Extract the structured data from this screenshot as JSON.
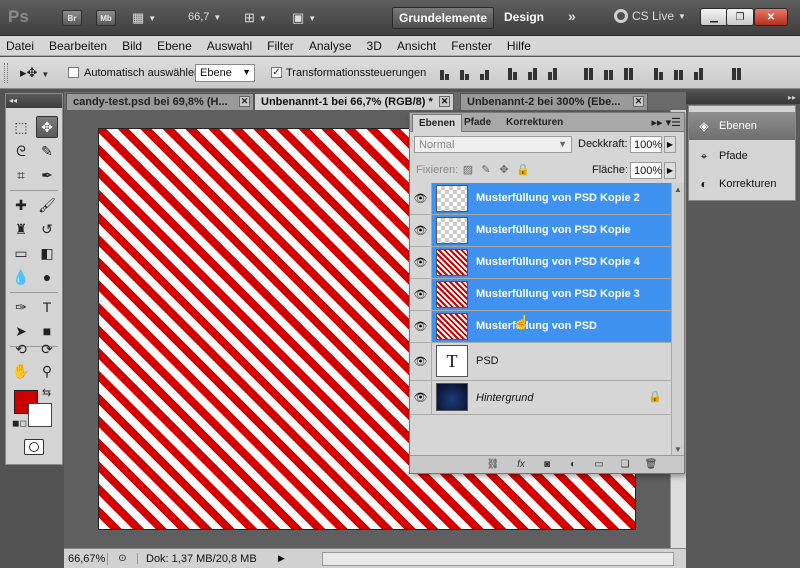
{
  "appbar": {
    "logo": "Ps",
    "bridge": "Br",
    "minibridge": "Mb",
    "zoom": "66,7",
    "workspace_active": "Grundelemente",
    "workspace_other": "Design",
    "more": "»",
    "cs_live": "CS Live"
  },
  "menu": [
    "Datei",
    "Bearbeiten",
    "Bild",
    "Ebene",
    "Auswahl",
    "Filter",
    "Analyse",
    "3D",
    "Ansicht",
    "Fenster",
    "Hilfe"
  ],
  "options": {
    "auto_select_label": "Automatisch auswählen:",
    "auto_select_checked": false,
    "auto_select_value": "Ebene",
    "transform_label": "Transformationssteuerungen",
    "transform_checked": true
  },
  "doc_tabs": [
    {
      "label": "candy-test.psd bei 69,8% (H...",
      "active": false
    },
    {
      "label": "Unbenannt-1 bei 66,7% (RGB/8) *",
      "active": true
    },
    {
      "label": "Unbenannt-2 bei 300% (Ebe...",
      "active": false
    }
  ],
  "canvas": {
    "stripe_colors": [
      "#d40000",
      "#ffffff"
    ]
  },
  "status": {
    "zoom": "66,67%",
    "doc_info": "Dok: 1,37 MB/20,8 MB"
  },
  "layers_panel": {
    "tabs": [
      "Ebenen",
      "Pfade",
      "Korrekturen"
    ],
    "blend_mode": "Normal",
    "opacity_label": "Deckkraft:",
    "opacity": "100%",
    "lock_label": "Fixieren:",
    "fill_label": "Fläche:",
    "fill": "100%",
    "layers": [
      {
        "name": "Musterfüllung von PSD Kopie 2",
        "thumb": "checker",
        "selected": true
      },
      {
        "name": "Musterfüllung von PSD Kopie",
        "thumb": "checker",
        "selected": true
      },
      {
        "name": "Musterfüllung von PSD Kopie 4",
        "thumb": "stripe",
        "selected": true
      },
      {
        "name": "Musterfüllung von PSD Kopie 3",
        "thumb": "stripe",
        "selected": true
      },
      {
        "name": "Musterfüllung von PSD",
        "thumb": "stripe",
        "selected": true
      },
      {
        "name": "PSD",
        "thumb": "text",
        "selected": false
      },
      {
        "name": "Hintergrund",
        "thumb": "bg",
        "selected": false
      }
    ]
  },
  "dock": {
    "items": [
      "Ebenen",
      "Pfade",
      "Korrekturen"
    ]
  },
  "colors": {
    "foreground": "#cc0000",
    "background": "#ffffff",
    "selection": "#3f92ef"
  }
}
